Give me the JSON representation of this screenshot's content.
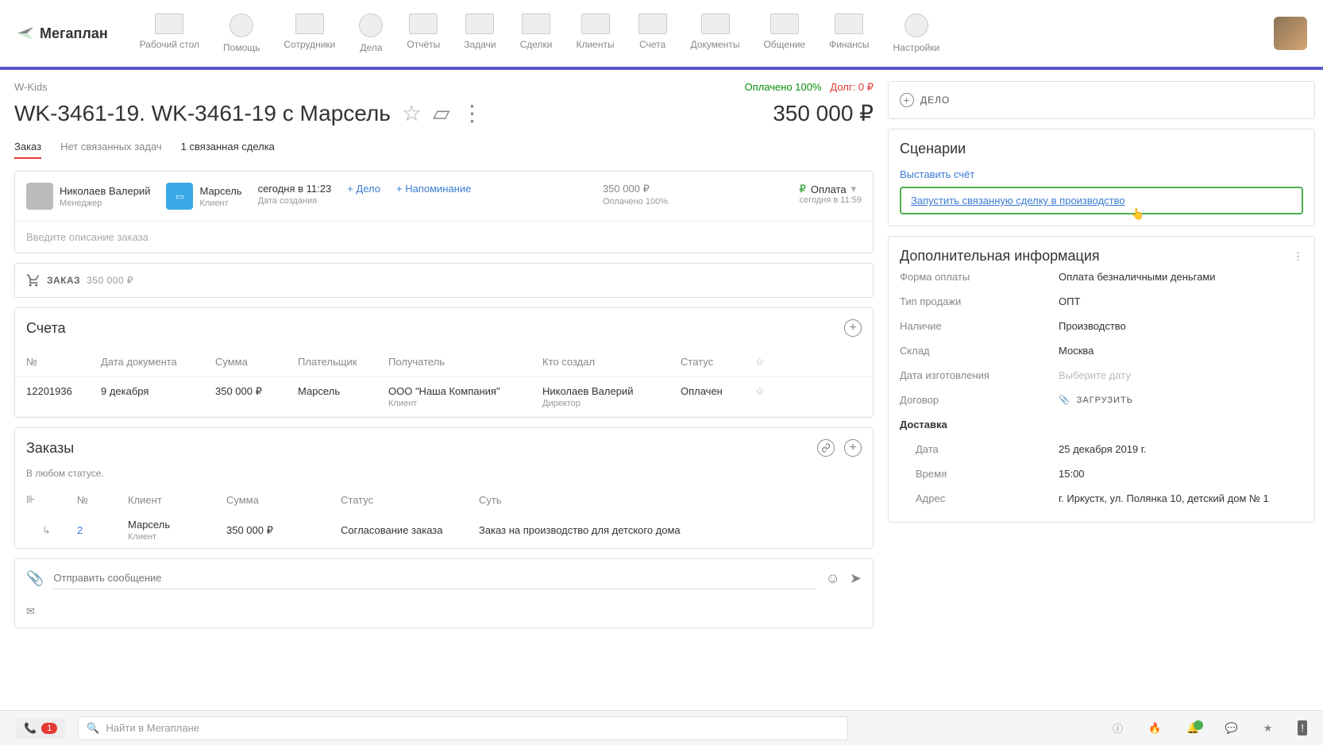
{
  "nav": {
    "items": [
      "Рабочий стол",
      "Помощь",
      "Сотрудники",
      "Дела",
      "Отчёты",
      "Задачи",
      "Сделки",
      "Клиенты",
      "Счета",
      "Документы",
      "Общение",
      "Финансы",
      "Настройки"
    ],
    "logo": "Мегаплан"
  },
  "breadcrumb": "W-Kids",
  "status": {
    "paid": "Оплачено 100%",
    "debt_label": "Долг:",
    "debt_value": "0 ₽"
  },
  "title": "WK-3461-19. WK-3461-19 с Марсель",
  "amount": "350 000 ₽",
  "tabs": {
    "t0": "Заказ",
    "t1": "Нет связанных задач",
    "t2": "1 связанная сделка"
  },
  "header": {
    "manager_name": "Николаев Валерий",
    "manager_role": "Менеджер",
    "client_name": "Марсель",
    "client_role": "Клиент",
    "created_date": "сегодня в 11:23",
    "created_label": "Дата создания",
    "act_delo": "+ Дело",
    "act_remind": "+ Напоминание",
    "money": "350 000 ₽",
    "money_sub": "Оплачено 100%",
    "status": "Оплата",
    "status_time": "сегодня в 11:59",
    "desc_placeholder": "Введите описание заказа"
  },
  "order_bar": {
    "label": "ЗАКАЗ",
    "amount": "350 000 ₽"
  },
  "bills": {
    "title": "Счета",
    "headers": {
      "num": "№",
      "date": "Дата документа",
      "sum": "Сумма",
      "payer": "Плательщик",
      "recv": "Получатель",
      "creator": "Кто создал",
      "status": "Статус"
    },
    "row": {
      "num": "12201936",
      "date": "9 декабря",
      "sum": "350 000 ₽",
      "payer": "Марсель",
      "recv": "ООО \"Наша Компания\"",
      "recv_sub": "Клиент",
      "creator": "Николаев Валерий",
      "creator_sub": "Директор",
      "status": "Оплачен"
    }
  },
  "orders": {
    "title": "Заказы",
    "any_status": "В любом статусе.",
    "headers": {
      "num": "№",
      "client": "Клиент",
      "sum": "Сумма",
      "status": "Статус",
      "subject": "Суть"
    },
    "row": {
      "num": "2",
      "client": "Марсель",
      "client_sub": "Клиент",
      "sum": "350 000 ₽",
      "status": "Согласование заказа",
      "subject": "Заказ на производство для детского дома"
    }
  },
  "message": {
    "placeholder": "Отправить сообщение"
  },
  "right": {
    "delo": "ДЕЛО",
    "scenarios_title": "Сценарии",
    "scenario1": "Выставить счёт",
    "scenario2": "Запустить связанную сделку в производство",
    "info_title": "Дополнительная информация",
    "fields": {
      "pay_form_l": "Форма оплаты",
      "pay_form_v": "Оплата безналичными деньгами",
      "sale_type_l": "Тип продажи",
      "sale_type_v": "ОПТ",
      "avail_l": "Наличие",
      "avail_v": "Производство",
      "stock_l": "Склад",
      "stock_v": "Москва",
      "mfg_l": "Дата изготовления",
      "mfg_v": "Выберите дату",
      "contract_l": "Договор",
      "contract_v": "ЗАГРУЗИТЬ",
      "delivery": "Доставка",
      "date_l": "Дата",
      "date_v": "25 декабря 2019 г.",
      "time_l": "Время",
      "time_v": "15:00",
      "addr_l": "Адрес",
      "addr_v": "г. Иркустк, ул. Полянка 10, детский дом № 1"
    }
  },
  "bottom": {
    "search_placeholder": "Найти в Мегаплане",
    "phone_badge": "1"
  }
}
